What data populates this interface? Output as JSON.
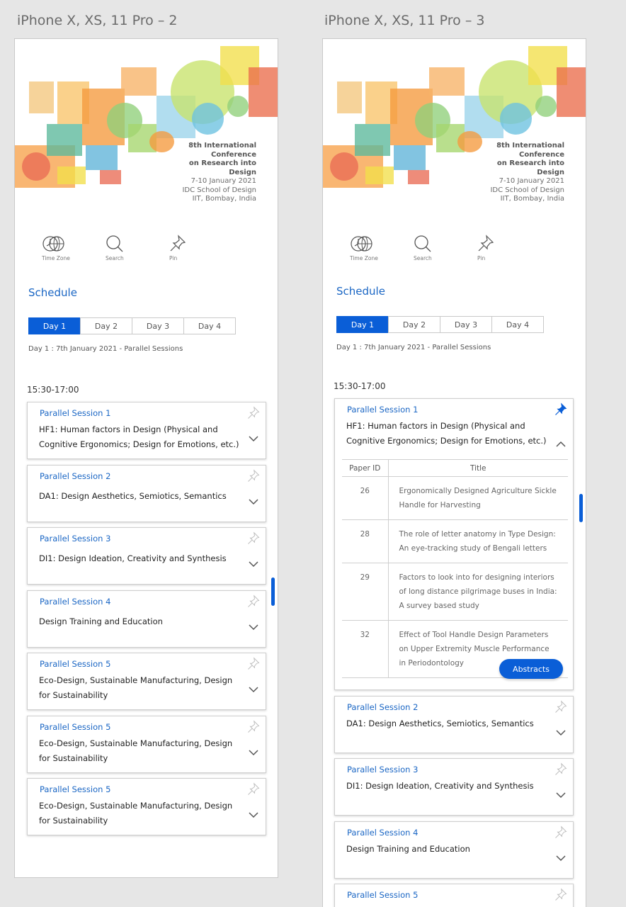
{
  "artboards": [
    {
      "label": "iPhone X, XS, 11 Pro – 2"
    },
    {
      "label": "iPhone X, XS, 11 Pro – 3"
    }
  ],
  "banner": {
    "line1": "8th International",
    "line2": "Conference",
    "line3": "on Research into",
    "line4": "Design",
    "line5": "7-10 January 2021",
    "line6": "IDC School of Design",
    "line7": "IIT, Bombay, India"
  },
  "toolbar": {
    "timezone": {
      "label": "Time Zone",
      "icon": "globe-clock-icon"
    },
    "search": {
      "label": "Search",
      "icon": "search-icon"
    },
    "pin": {
      "label": "Pin",
      "icon": "pin-icon"
    }
  },
  "schedule_title": "Schedule",
  "tabs": [
    {
      "label": "Day 1",
      "active": true
    },
    {
      "label": "Day 2"
    },
    {
      "label": "Day 3"
    },
    {
      "label": "Day 4"
    }
  ],
  "day_info": "Day 1 : 7th January 2021 - Parallel Sessions",
  "time_slot": "15:30-17:00",
  "sessions": [
    {
      "session": "Parallel Session 1",
      "track": "HF1: Human factors in Design (Physical and Cognitive Ergonomics; Design for Emotions, etc.)"
    },
    {
      "session": "Parallel Session 2",
      "track": "DA1: Design Aesthetics, Semiotics, Semantics"
    },
    {
      "session": "Parallel Session 3",
      "track": "DI1: Design Ideation, Creativity and Synthesis"
    },
    {
      "session": "Parallel Session 4",
      "track": "Design Training and Education"
    },
    {
      "session": "Parallel Session 5",
      "track": "Eco-Design, Sustainable Manufacturing, Design for Sustainability"
    },
    {
      "session": "Parallel Session 5",
      "track": "Eco-Design, Sustainable Manufacturing, Design for Sustainability"
    },
    {
      "session": "Parallel Session 5",
      "track": "Eco-Design, Sustainable Manufacturing, Design for Sustainability"
    }
  ],
  "expanded_session": {
    "session": "Parallel Session 1",
    "track": "HF1: Human factors in Design (Physical and Cognitive Ergonomics; Design for Emotions, etc.)",
    "table_headers": {
      "paper_id": "Paper ID",
      "title": "Title"
    },
    "papers": [
      {
        "id": "26",
        "title": "Ergonomically Designed Agriculture Sickle Handle for Harvesting"
      },
      {
        "id": "28",
        "title": "The role of letter anatomy in Type Design: An eye-tracking study of Bengali letters"
      },
      {
        "id": "29",
        "title": "Factors to look into for designing interiors of long distance pilgrimage buses in India: A survey based study"
      },
      {
        "id": "32",
        "title": "Effect of Tool Handle Design Parameters on Upper Extremity Muscle Performance in Periodontology"
      }
    ],
    "abstracts_label": "Abstracts"
  },
  "colors": {
    "accent": "#0a5ed7",
    "link": "#1a66c4"
  }
}
